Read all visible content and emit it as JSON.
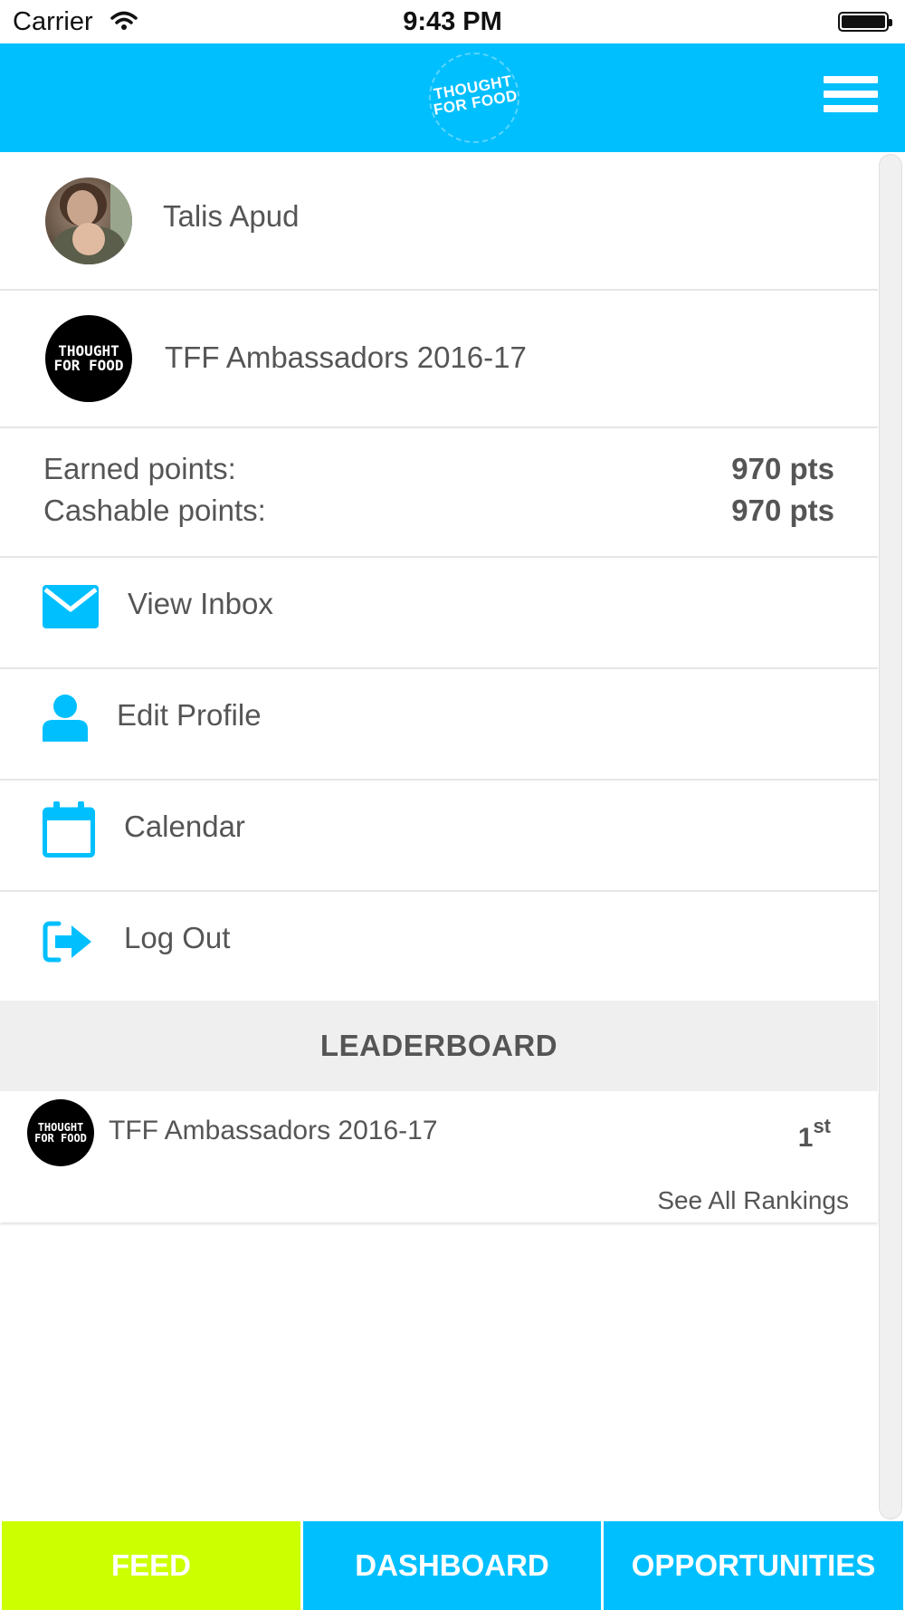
{
  "status_bar": {
    "carrier": "Carrier",
    "time": "9:43 PM"
  },
  "header": {
    "logo_text_line1": "THOUGHT",
    "logo_text_line2": "FOR FOOD",
    "menu_icon": "hamburger-menu-icon"
  },
  "user": {
    "name": "Talis Apud"
  },
  "group": {
    "name": "TFF Ambassadors 2016-17",
    "logo_line1": "THOUGHT",
    "logo_line2": "FOR FOOD"
  },
  "points": {
    "earned_label": "Earned points:",
    "earned_value": "970 pts",
    "cashable_label": "Cashable points:",
    "cashable_value": "970 pts"
  },
  "menu": {
    "inbox": {
      "label": "View Inbox",
      "icon": "envelope-icon"
    },
    "profile": {
      "label": "Edit Profile",
      "icon": "user-icon"
    },
    "calendar": {
      "label": "Calendar",
      "icon": "calendar-icon"
    },
    "logout": {
      "label": "Log Out",
      "icon": "logout-icon"
    }
  },
  "leaderboard": {
    "title": "LEADERBOARD",
    "entry": {
      "name": "TFF Ambassadors 2016-17",
      "rank": "1",
      "rank_suffix": "st"
    },
    "see_all": "See All Rankings"
  },
  "tabs": {
    "feed": "FEED",
    "dashboard": "DASHBOARD",
    "opportunities": "OPPORTUNITIES"
  },
  "colors": {
    "accent": "#00bfff",
    "feed_tab": "#ccff00",
    "text": "#555555"
  }
}
